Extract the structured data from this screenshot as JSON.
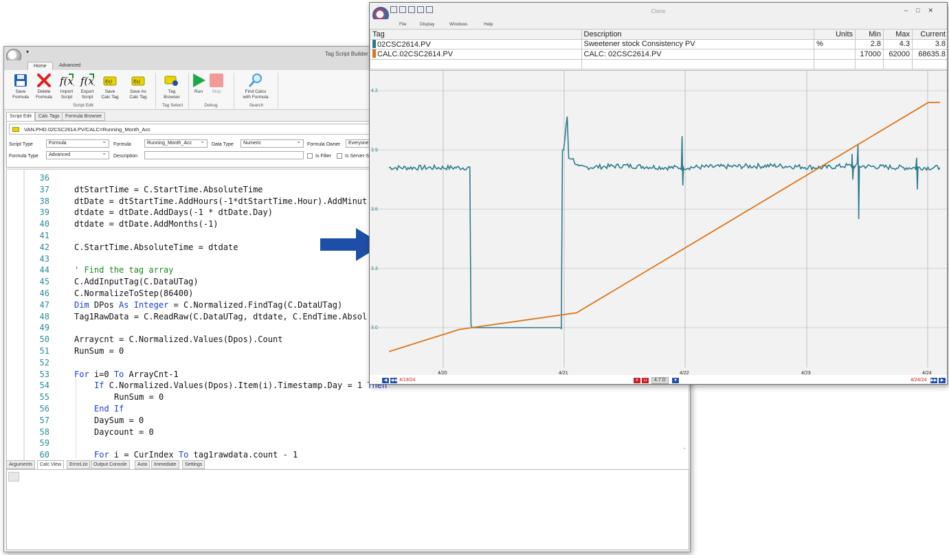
{
  "script_builder": {
    "window_title": "Tag Script Builder",
    "ribbon_tabs": [
      "Home",
      "Advanced"
    ],
    "ribbon_buttons": {
      "save_formula": "Save\nFormula",
      "delete_formula": "Delete\nFormula",
      "import_script": "Import\nScript",
      "export_script": "Export\nScript",
      "save_calc_tag": "Save\nCalc Tag",
      "save_as_calc_tag": "Save As\nCalc Tag",
      "tag_browser": "Tag\nBrowser",
      "run": "Run",
      "stop": "Stop",
      "find_calcs": "Find Calcs\nwith Formula"
    },
    "ribbon_groups": {
      "script_edit": "Script Edit",
      "tag_select": "Tag Select",
      "debug": "Debug",
      "search": "Search"
    },
    "sub_tabs": [
      "Script Edit",
      "Calc Tags",
      "Formula Browser"
    ],
    "tag_path": "VAN.PHD.02CSC2614.PV/CALC=Running_Month_Acc",
    "fields": {
      "script_type_label": "Script Type",
      "script_type_value": "Formula",
      "formula_label": "Formula",
      "formula_value": "Running_Month_Acc",
      "data_type_label": "Data Type",
      "data_type_value": "Numeric",
      "formula_owner_label": "Formula Owner",
      "formula_owner_value": "Everyone",
      "formula_type_label": "Formula Type",
      "formula_type_value": "Advanced",
      "description_label": "Description",
      "description_value": "",
      "is_filter_label": "Is Filter",
      "is_server_label": "Is Server-S"
    },
    "code_lines": [
      {
        "n": "36",
        "indent": 0,
        "parts": []
      },
      {
        "n": "37",
        "indent": 0,
        "parts": [
          [
            "t",
            "dtStartTime = C.StartTime.AbsoluteTime"
          ]
        ]
      },
      {
        "n": "38",
        "indent": 0,
        "parts": [
          [
            "t",
            "dtDate = dtStartTime.AddHours(-1*dtStartTime.Hour).AddMinut"
          ]
        ]
      },
      {
        "n": "39",
        "indent": 0,
        "parts": [
          [
            "t",
            "dtdate = dtDate.AddDays(-1 * dtDate.Day)"
          ]
        ]
      },
      {
        "n": "40",
        "indent": 0,
        "parts": [
          [
            "t",
            "dtdate = dtDate.AddMonths(-1)"
          ]
        ]
      },
      {
        "n": "41",
        "indent": 0,
        "parts": []
      },
      {
        "n": "42",
        "indent": 0,
        "parts": [
          [
            "t",
            "C.StartTime.AbsoluteTime = dtdate"
          ]
        ]
      },
      {
        "n": "43",
        "indent": 0,
        "parts": []
      },
      {
        "n": "44",
        "indent": 0,
        "parts": [
          [
            "c",
            "' Find the tag array"
          ]
        ]
      },
      {
        "n": "45",
        "indent": 0,
        "parts": [
          [
            "t",
            "C.AddInputTag(C.DataUTag)"
          ]
        ]
      },
      {
        "n": "46",
        "indent": 0,
        "parts": [
          [
            "t",
            "C.NormalizeToStep(86400)"
          ]
        ]
      },
      {
        "n": "47",
        "indent": 0,
        "parts": [
          [
            "k",
            "Dim"
          ],
          [
            "t",
            " DPos "
          ],
          [
            "k",
            "As"
          ],
          [
            "t",
            " "
          ],
          [
            "k",
            "Integer"
          ],
          [
            "t",
            " = C.Normalized.FindTag(C.DataUTag)"
          ]
        ]
      },
      {
        "n": "48",
        "indent": 0,
        "parts": [
          [
            "t",
            "Tag1RawData = C.ReadRaw(C.DataUTag, dtdate, C.EndTime.Absol"
          ]
        ]
      },
      {
        "n": "49",
        "indent": 0,
        "parts": []
      },
      {
        "n": "50",
        "indent": 0,
        "parts": [
          [
            "t",
            "Arraycnt = C.Normalized.Values(Dpos).Count"
          ]
        ]
      },
      {
        "n": "51",
        "indent": 0,
        "parts": [
          [
            "t",
            "RunSum = 0"
          ]
        ]
      },
      {
        "n": "52",
        "indent": 0,
        "parts": []
      },
      {
        "n": "53",
        "indent": 0,
        "parts": [
          [
            "k",
            "For"
          ],
          [
            "t",
            " i=0 "
          ],
          [
            "k",
            "To"
          ],
          [
            "t",
            " ArrayCnt-1"
          ]
        ]
      },
      {
        "n": "54",
        "indent": 1,
        "parts": [
          [
            "k",
            "If"
          ],
          [
            "t",
            " C.Normalized.Values(Dpos).Item(i).Timestamp.Day = 1 "
          ],
          [
            "k",
            "Then"
          ]
        ]
      },
      {
        "n": "55",
        "indent": 2,
        "parts": [
          [
            "t",
            "RunSum = 0"
          ]
        ]
      },
      {
        "n": "56",
        "indent": 1,
        "parts": [
          [
            "k",
            "End If"
          ]
        ]
      },
      {
        "n": "57",
        "indent": 1,
        "parts": [
          [
            "t",
            "DaySum = 0"
          ]
        ]
      },
      {
        "n": "58",
        "indent": 1,
        "parts": [
          [
            "t",
            "Daycount = 0"
          ]
        ]
      },
      {
        "n": "59",
        "indent": 0,
        "parts": []
      },
      {
        "n": "60",
        "indent": 1,
        "parts": [
          [
            "k",
            "For"
          ],
          [
            "t",
            " i = CurIndex "
          ],
          [
            "k",
            "To"
          ],
          [
            "t",
            " tag1rawdata.count - 1"
          ]
        ]
      }
    ],
    "bottom_tabs": [
      "Arguments",
      "Calc View",
      "ErrorList",
      "Output Console",
      "Auto",
      "Immediate",
      "Settings"
    ]
  },
  "clone": {
    "window_title": "Clone",
    "menu": [
      "File",
      "Display",
      "Windows",
      "Help"
    ],
    "table_headers": [
      "Tag",
      "Description",
      "Units",
      "Min",
      "Max",
      "Current"
    ],
    "rows": [
      {
        "tag": "02CSC2614.PV",
        "description": "Sweetener stock Consistency PV",
        "units": "%",
        "min": "2.8",
        "max": "4.3",
        "current": "3.8",
        "color": "#2b7b8c"
      },
      {
        "tag": "CALC.02CSC2614.PV",
        "description": "CALC: 02CSC2614.PV",
        "units": "",
        "min": "17000",
        "max": "62000",
        "current": "68635.8",
        "color": "#d9761a"
      }
    ],
    "nav": {
      "start": "4/19/24",
      "end": "4/24/24",
      "span": "4.7 D"
    }
  },
  "chart_data": {
    "type": "line",
    "x_ticks": [
      "4/20",
      "4/21",
      "4/22",
      "4/23",
      "4/24"
    ],
    "y_ticks": [
      "4.2",
      "3.9",
      "3.6",
      "3.3",
      "3.0"
    ],
    "ylim": [
      2.8,
      4.3
    ],
    "xlim": [
      "4/19/24",
      "4/24/24"
    ],
    "grid": true,
    "series": [
      {
        "name": "02CSC2614.PV",
        "color": "#2b7b8c",
        "x_days": [
          0.0,
          0.69,
          0.71,
          1.47,
          1.49,
          1.52,
          1.56,
          1.62,
          2.0,
          2.4,
          3.3,
          3.7,
          3.9,
          4.4,
          4.7
        ],
        "values": [
          3.81,
          3.81,
          3.0,
          3.0,
          3.9,
          4.07,
          3.86,
          3.81,
          3.82,
          3.81,
          3.82,
          3.81,
          3.82,
          3.81,
          3.81
        ]
      },
      {
        "name": "CALC.02CSC2614.PV",
        "color": "#d9761a",
        "x_days": [
          0.0,
          0.6,
          1.6,
          4.6,
          4.7
        ],
        "values": [
          17000,
          21000,
          24000,
          62000,
          62000
        ],
        "ylim": [
          14500,
          66000
        ]
      }
    ]
  }
}
